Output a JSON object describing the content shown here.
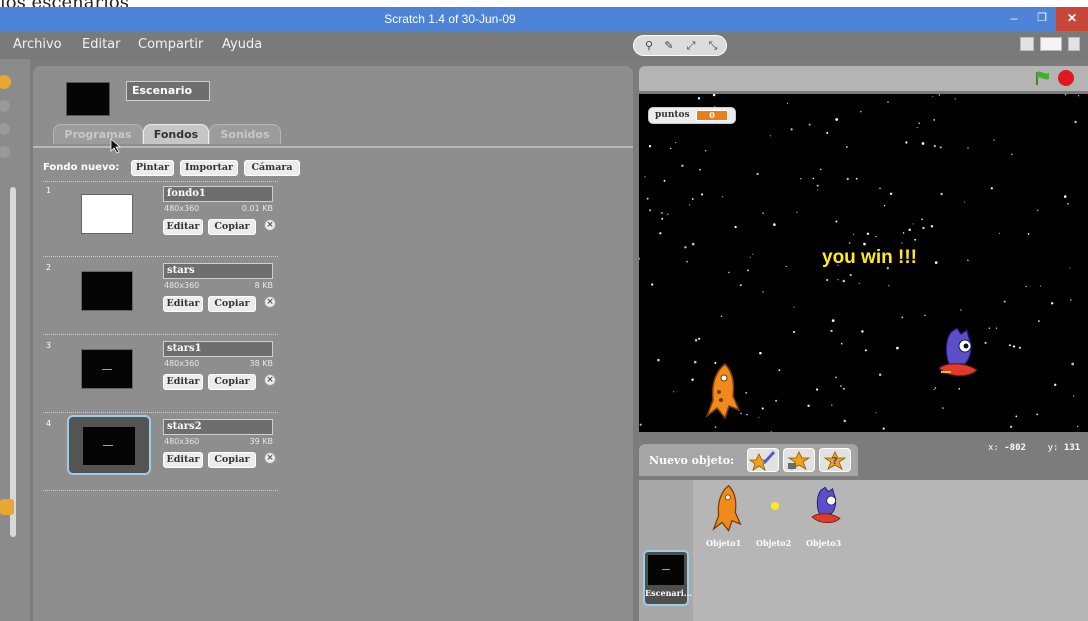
{
  "caption": "los escenarios",
  "window": {
    "title": "Scratch 1.4 of 30-Jun-09",
    "minimize": "–",
    "maximize": "❐",
    "close": "✕"
  },
  "menu": [
    "Archivo",
    "Editar",
    "Compartir",
    "Ayuda"
  ],
  "stage_tools": [
    "⚲",
    "✎",
    "⤢",
    "⤡"
  ],
  "editor": {
    "object_name": "Escenario",
    "tabs": [
      "Programas",
      "Fondos",
      "Sonidos"
    ],
    "active_tab": "Fondos",
    "new_background_label": "Fondo nuevo:",
    "new_background_buttons": [
      "Pintar",
      "Importar",
      "Cámara"
    ],
    "edit_label": "Editar",
    "copy_label": "Copiar",
    "delete_icon": "×",
    "backgrounds": [
      {
        "num": "1",
        "name": "fondo1",
        "dims": "480x360",
        "size": "0.01 KB",
        "thumb": "#ffffff"
      },
      {
        "num": "2",
        "name": "stars",
        "dims": "480x360",
        "size": "8 KB",
        "thumb": "#050505"
      },
      {
        "num": "3",
        "name": "stars1",
        "dims": "480x360",
        "size": "38 KB",
        "thumb": "#050505"
      },
      {
        "num": "4",
        "name": "stars2",
        "dims": "480x360",
        "size": "39 KB",
        "thumb": "#050505",
        "selected": true
      }
    ]
  },
  "stage": {
    "variable_name": "puntos",
    "variable_value": "0",
    "message": "you win !!!"
  },
  "coords": {
    "x_label": "x:",
    "x": "-802",
    "y_label": "y:",
    "y": "131"
  },
  "sprites": {
    "new_sprite_label": "Nuevo objeto:",
    "items": [
      "Objeto1",
      "Objeto2",
      "Objeto3"
    ],
    "stage_label": "Escenari..."
  },
  "colors": {
    "titlebar": "#4d84d8",
    "accent_orange": "#ec7d1b",
    "message_yellow": "#ffea1c",
    "stop_red": "#e0191e"
  }
}
